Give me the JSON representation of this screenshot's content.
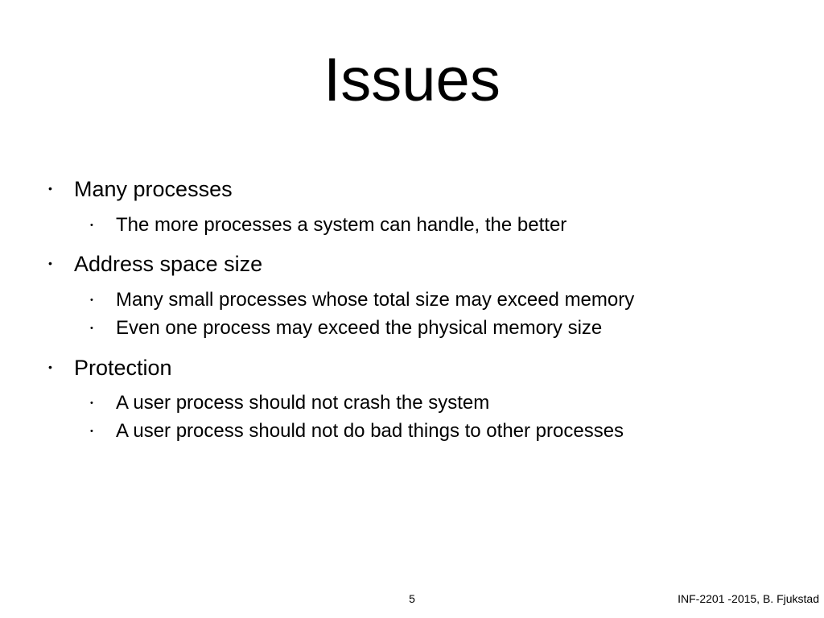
{
  "title": "Issues",
  "bullets": [
    {
      "text": "Many processes",
      "sub": [
        "The more processes a system can handle, the better"
      ]
    },
    {
      "text": "Address space size",
      "sub": [
        "Many small processes whose total size may exceed memory",
        "Even one process may exceed the physical memory size"
      ]
    },
    {
      "text": "Protection",
      "sub": [
        "A user process should not crash the system",
        "A user process should not do bad things to other processes"
      ]
    }
  ],
  "pageNumber": "5",
  "footer": "INF-2201 -2015, B. Fjukstad"
}
